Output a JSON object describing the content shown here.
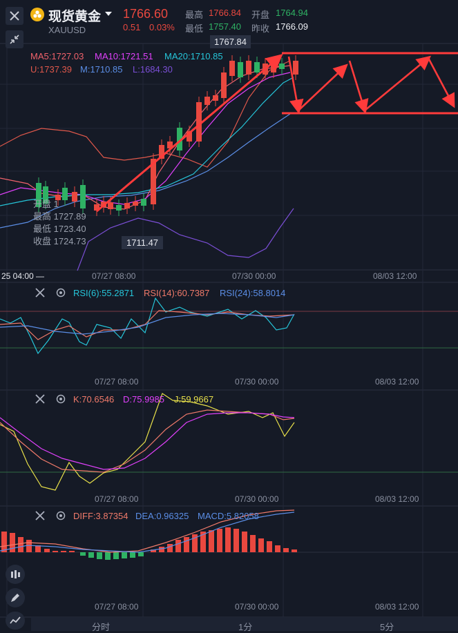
{
  "header": {
    "title": "现货黄金",
    "symbol": "XAUUSD",
    "price": "1766.60",
    "change": "0.51",
    "change_pct": "0.03%",
    "high_label": "最高",
    "high": "1766.84",
    "open_label": "开盘",
    "open": "1764.94",
    "low_label": "最低",
    "low": "1757.40",
    "prev_close_label": "昨收",
    "prev_close": "1766.09"
  },
  "main_chart": {
    "peak_label": "1767.84",
    "trough_label": "1711.47",
    "ma_line": {
      "ma5": "MA5:1727.03",
      "ma10": "MA10:1721.51",
      "ma20": "MA20:1710.85"
    },
    "boll_line": {
      "u": "U:1737.39",
      "m": "M:1710.85",
      "l": "L:1684.30"
    },
    "ohlc_tooltip": {
      "open": "开盘 1",
      "high": "最高 1727.89",
      "low": "最低 1723.40",
      "close": "收盘 1724.73"
    },
    "x_labels": {
      "left": "25 04:00 —",
      "a": "07/27 08:00",
      "b": "07/30 00:00",
      "c": "08/03 12:00"
    }
  },
  "rsi_panel": {
    "rsi6": "RSI(6):55.2871",
    "rsi14": "RSI(14):60.7387",
    "rsi24": "RSI(24):58.8014",
    "x_a": "07/27 08:00",
    "x_b": "07/30 00:00",
    "x_c": "08/03 12:00"
  },
  "kdj_panel": {
    "k": "K:70.6546",
    "d": "D:75.9985",
    "j": "J:59.9667",
    "x_a": "07/27 08:00",
    "x_b": "07/30 00:00",
    "x_c": "08/03 12:00"
  },
  "macd_panel": {
    "diff": "DIFF:3.87354",
    "dea": "DEA:0.96325",
    "macd": "MACD:5.82058",
    "x_a": "07/27 08:00",
    "x_b": "07/30 00:00",
    "x_c": "08/03 12:00"
  },
  "bottom_tabs": [
    "分时",
    "1分",
    "5分"
  ],
  "colors": {
    "bg": "#151a26",
    "up": "#e9483f",
    "down": "#2fb264",
    "ma5": "#f0626b",
    "ma10": "#e040fb",
    "ma20": "#26c6da",
    "boll_u": "#e0584b",
    "boll_m": "#5b8ee6",
    "boll_l": "#7b4fd6",
    "rsi6": "#26c6da",
    "rsi14": "#f07a6a",
    "rsi24": "#5b8ee6",
    "k": "#f07a6a",
    "d": "#e040fb",
    "j": "#e8e04a",
    "diff": "#f07a6a",
    "dea": "#5b8ee6"
  }
}
